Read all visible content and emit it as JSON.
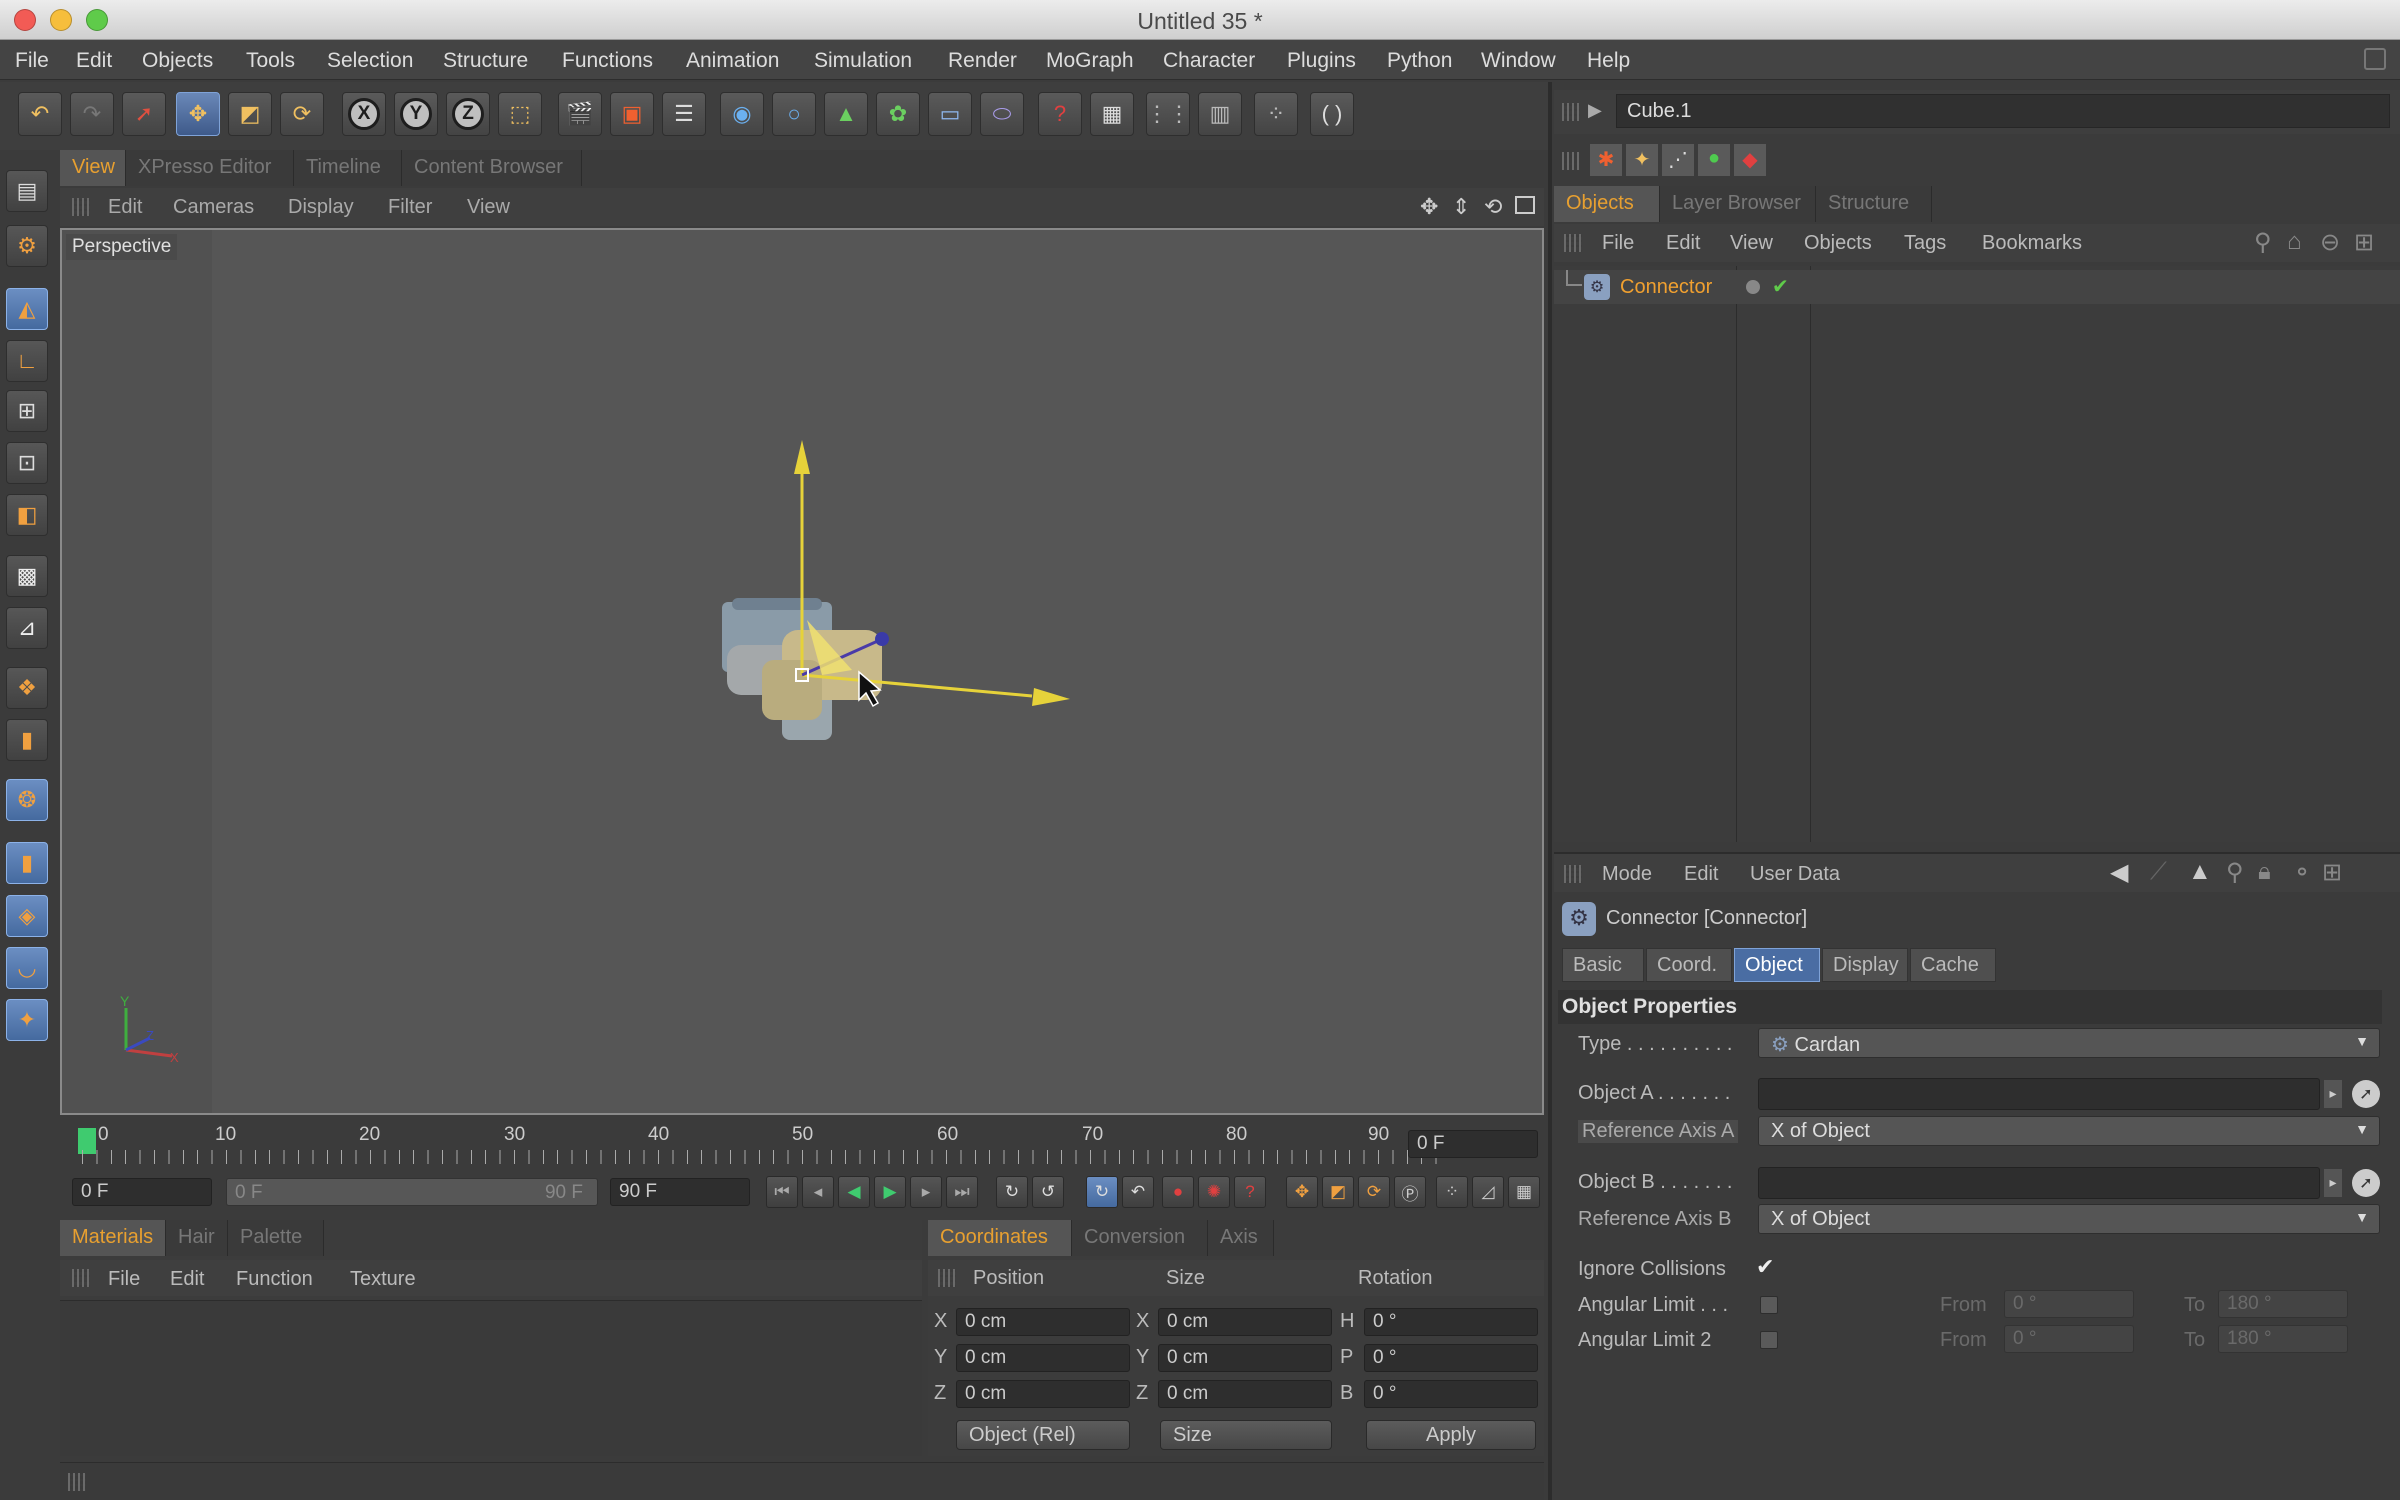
{
  "window": {
    "title": "Untitled 35 *"
  },
  "menu": [
    "File",
    "Edit",
    "Objects",
    "Tools",
    "Selection",
    "Structure",
    "Functions",
    "Animation",
    "Simulation",
    "Render",
    "MoGraph",
    "Character",
    "Plugins",
    "Python",
    "Window",
    "Help"
  ],
  "viewport": {
    "tabs": [
      "View",
      "XPresso Editor",
      "Timeline",
      "Content Browser"
    ],
    "menu": [
      "Edit",
      "Cameras",
      "Display",
      "Filter",
      "View"
    ],
    "camera_label": "Perspective"
  },
  "timeline": {
    "ticks": [
      "0",
      "10",
      "20",
      "30",
      "40",
      "50",
      "60",
      "70",
      "80",
      "90"
    ],
    "current_frame": "0 F",
    "start_field": "0 F",
    "range_start": "0 F",
    "range_end": "90 F",
    "end_field": "90 F"
  },
  "materials": {
    "tabs": [
      "Materials",
      "Hair",
      "Palette"
    ],
    "menu": [
      "File",
      "Edit",
      "Function",
      "Texture"
    ]
  },
  "coordinates": {
    "tabs": [
      "Coordinates",
      "Conversion",
      "Axis"
    ],
    "headers": [
      "Position",
      "Size",
      "Rotation"
    ],
    "rows": [
      {
        "pos_axis": "X",
        "pos": "0 cm",
        "size_axis": "X",
        "size": "0 cm",
        "rot_axis": "H",
        "rot": "0 °"
      },
      {
        "pos_axis": "Y",
        "pos": "0 cm",
        "size_axis": "Y",
        "size": "0 cm",
        "rot_axis": "P",
        "rot": "0 °"
      },
      {
        "pos_axis": "Z",
        "pos": "0 cm",
        "size_axis": "Z",
        "size": "0 cm",
        "rot_axis": "B",
        "rot": "0 °"
      }
    ],
    "mode": "Object (Rel)",
    "size_mode": "Size",
    "apply": "Apply"
  },
  "object_manager": {
    "header_field": "Cube.1",
    "tabs": [
      "Objects",
      "Layer Browser",
      "Structure"
    ],
    "menu": [
      "File",
      "Edit",
      "View",
      "Objects",
      "Tags",
      "Bookmarks"
    ],
    "objects": [
      {
        "name": "Connector"
      }
    ]
  },
  "attributes": {
    "menu": [
      "Mode",
      "Edit",
      "User Data"
    ],
    "object_title": "Connector [Connector]",
    "tabs": [
      "Basic",
      "Coord.",
      "Object",
      "Display",
      "Cache"
    ],
    "section": "Object Properties",
    "props": {
      "type_label": "Type . . . . . . . . . .",
      "type_value": "Cardan",
      "object_a_label": "Object A . . . . . . .",
      "ref_axis_a_label": "Reference Axis A",
      "ref_axis_a_value": "X of Object",
      "object_b_label": "Object B . . . . . . .",
      "ref_axis_b_label": "Reference Axis B",
      "ref_axis_b_value": "X of Object",
      "ignore_collisions_label": "Ignore Collisions",
      "angular_limit_label": "Angular Limit . . .",
      "angular_limit2_label": "Angular Limit 2",
      "from_label": "From",
      "to_label": "To",
      "from_value": "0 °",
      "to_value": "180 °"
    }
  }
}
